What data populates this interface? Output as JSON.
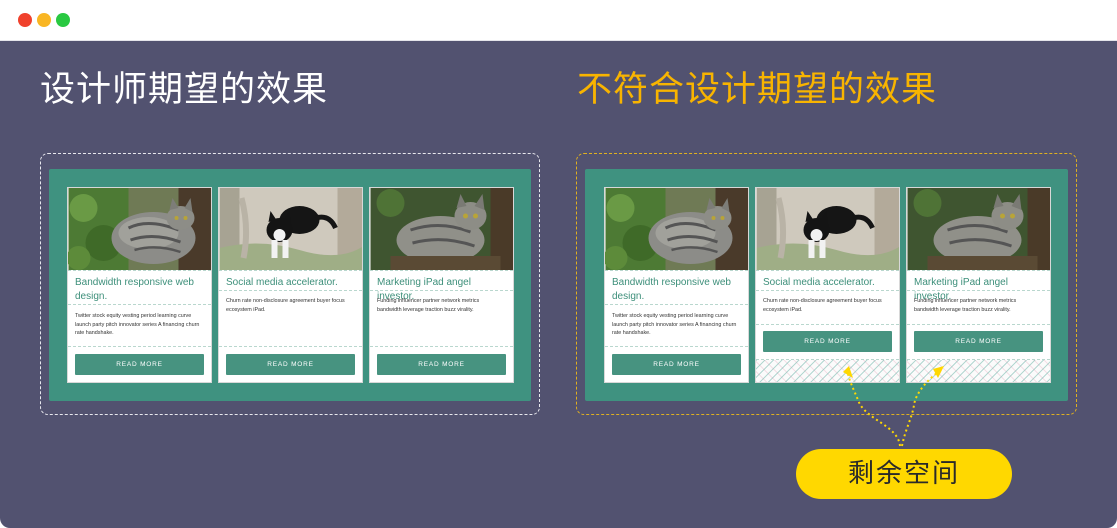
{
  "window": {
    "traffic_lights": [
      "close",
      "minimize",
      "zoom"
    ]
  },
  "left_heading": "设计师期望的效果",
  "right_heading": "不符合设计期望的效果",
  "callout_label": "剩余空间",
  "cards": [
    {
      "title": "Bandwidth responsive web design.",
      "body": "Twitter stock equity vesting period learning curve launch party pitch innovator series A financing churn rate handshake.",
      "button": "READ MORE",
      "photo": "tabby-cat-photo"
    },
    {
      "title": "Social media accelerator.",
      "body": "Churn rate non-disclosure agreement buyer focus ecosystem iPad.",
      "button": "READ MORE",
      "photo": "black-white-cat-photo"
    },
    {
      "title": "Marketing iPad angel investor.",
      "body": "Funding influencer partner network metrics bandwidth leverage traction buzz virality.",
      "button": "READ MORE",
      "photo": "tabby-cat-photo"
    }
  ],
  "colors": {
    "stage": "#525270",
    "panel": "#3f9280",
    "button": "#479380",
    "title": "#3d8f7a",
    "accent": "#f8b400",
    "pill": "#ffd800"
  }
}
